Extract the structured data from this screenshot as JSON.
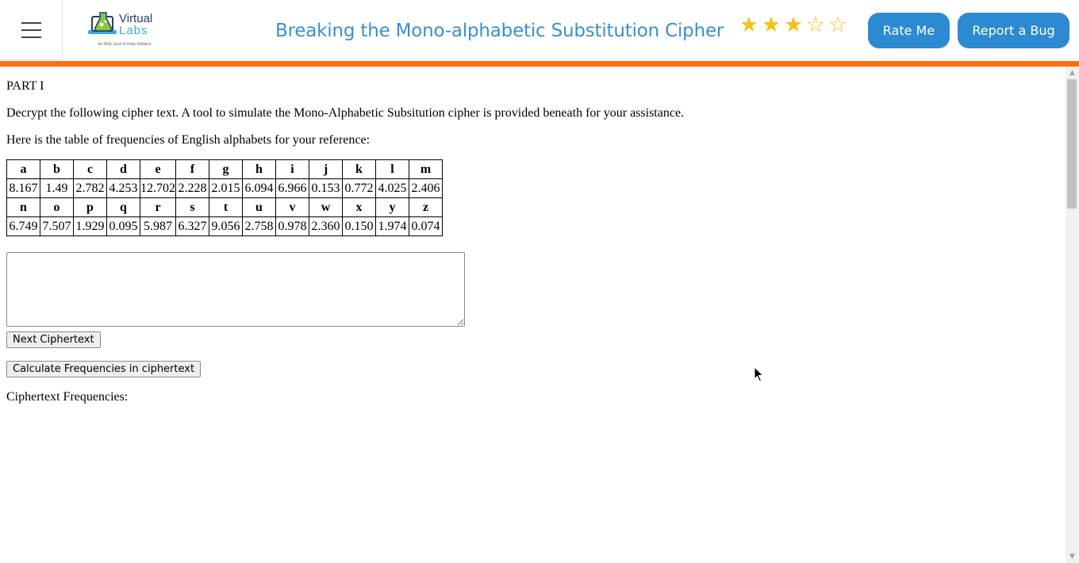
{
  "header": {
    "logo": {
      "word1": "Virtual",
      "word2": "Labs",
      "tagline": "An MoE Govt of India Initiative"
    },
    "title": "Breaking the Mono-alphabetic Substitution Cipher",
    "rating": {
      "filled": 3,
      "total": 5
    },
    "rate_label": "Rate Me",
    "bug_label": "Report a Bug",
    "accent_color": "#ff6e0d",
    "button_color": "#2b8ad1",
    "icons": [
      "hamburger-menu-icon",
      "virtual-labs-logo",
      "star-icon"
    ]
  },
  "content": {
    "part_heading": "PART I",
    "instructions": "Decrypt the following cipher text. A tool to simulate the Mono-Alphabetic Subsitution cipher is provided beneath for your assistance.",
    "reference_note": "Here is the table of frequencies of English alphabets for your reference:",
    "frequency_table": {
      "rows": [
        {
          "letters": [
            "a",
            "b",
            "c",
            "d",
            "e",
            "f",
            "g",
            "h",
            "i",
            "j",
            "k",
            "l",
            "m"
          ],
          "values": [
            "8.167",
            "1.49",
            "2.782",
            "4.253",
            "12.702",
            "2.228",
            "2.015",
            "6.094",
            "6.966",
            "0.153",
            "0.772",
            "4.025",
            "2.406"
          ]
        },
        {
          "letters": [
            "n",
            "o",
            "p",
            "q",
            "r",
            "s",
            "t",
            "u",
            "v",
            "w",
            "x",
            "y",
            "z"
          ],
          "values": [
            "6.749",
            "7.507",
            "1.929",
            "0.095",
            "5.987",
            "6.327",
            "9.056",
            "2.758",
            "0.978",
            "2.360",
            "0.150",
            "1.974",
            "0.074"
          ]
        }
      ]
    },
    "ciphertext_value": "",
    "next_button": "Next Ciphertext",
    "calc_button": "Calculate Frequencies in ciphertext",
    "frequencies_label": "Ciphertext Frequencies:"
  }
}
